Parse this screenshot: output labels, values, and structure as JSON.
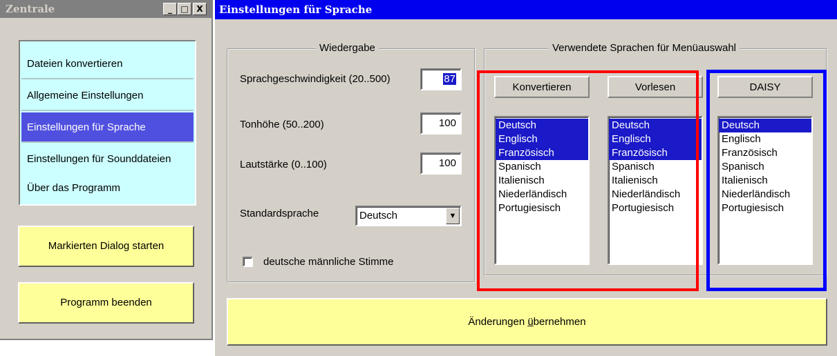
{
  "zentrale": {
    "title": "Zentrale",
    "window_buttons": {
      "minimize": "_",
      "maximize": "□",
      "close": "X"
    },
    "menu_items": [
      {
        "label": "Dateien konvertieren",
        "selected": false
      },
      {
        "label": "Allgemeine Einstellungen",
        "selected": false
      },
      {
        "label": "Einstellungen für Sprache",
        "selected": true
      },
      {
        "label": "Einstellungen für Sounddateien",
        "selected": false
      },
      {
        "label": "Über das Programm",
        "selected": false
      }
    ],
    "start_button": "Markierten Dialog starten",
    "exit_button": "Programm beenden"
  },
  "einstellungen": {
    "title": "Einstellungen für Sprache",
    "wiedergabe": {
      "legend": "Wiedergabe",
      "speed_label": "Sprachgeschwindigkeit (20..500)",
      "speed_value": "87",
      "pitch_label": "Tonhöhe (50..200)",
      "pitch_value": "100",
      "volume_label": "Lautstärke (0..100)",
      "volume_value": "100",
      "default_lang_label": "Standardsprache",
      "default_lang_value": "Deutsch",
      "dropdown_arrow": "▼",
      "male_voice_label": "deutsche männliche Stimme",
      "male_voice_checked": false
    },
    "languages": {
      "legend": "Verwendete Sprachen für Menüauswahl",
      "columns": [
        {
          "header": "Konvertieren",
          "selected": [
            "Deutsch",
            "Englisch",
            "Französisch"
          ]
        },
        {
          "header": "Vorlesen",
          "selected": [
            "Deutsch",
            "Englisch",
            "Französisch"
          ]
        },
        {
          "header": "DAISY",
          "selected": [
            "Deutsch"
          ]
        }
      ],
      "items": [
        "Deutsch",
        "Englisch",
        "Französisch",
        "Spanisch",
        "Italienisch",
        "Niederländisch",
        "Portugiesisch"
      ]
    },
    "apply_button": {
      "before": "Änderungen ",
      "accel": "ü",
      "after": "bernehmen"
    },
    "highlight_colors": {
      "red_frame": "#ff0000",
      "blue_frame": "#0000ff"
    }
  }
}
